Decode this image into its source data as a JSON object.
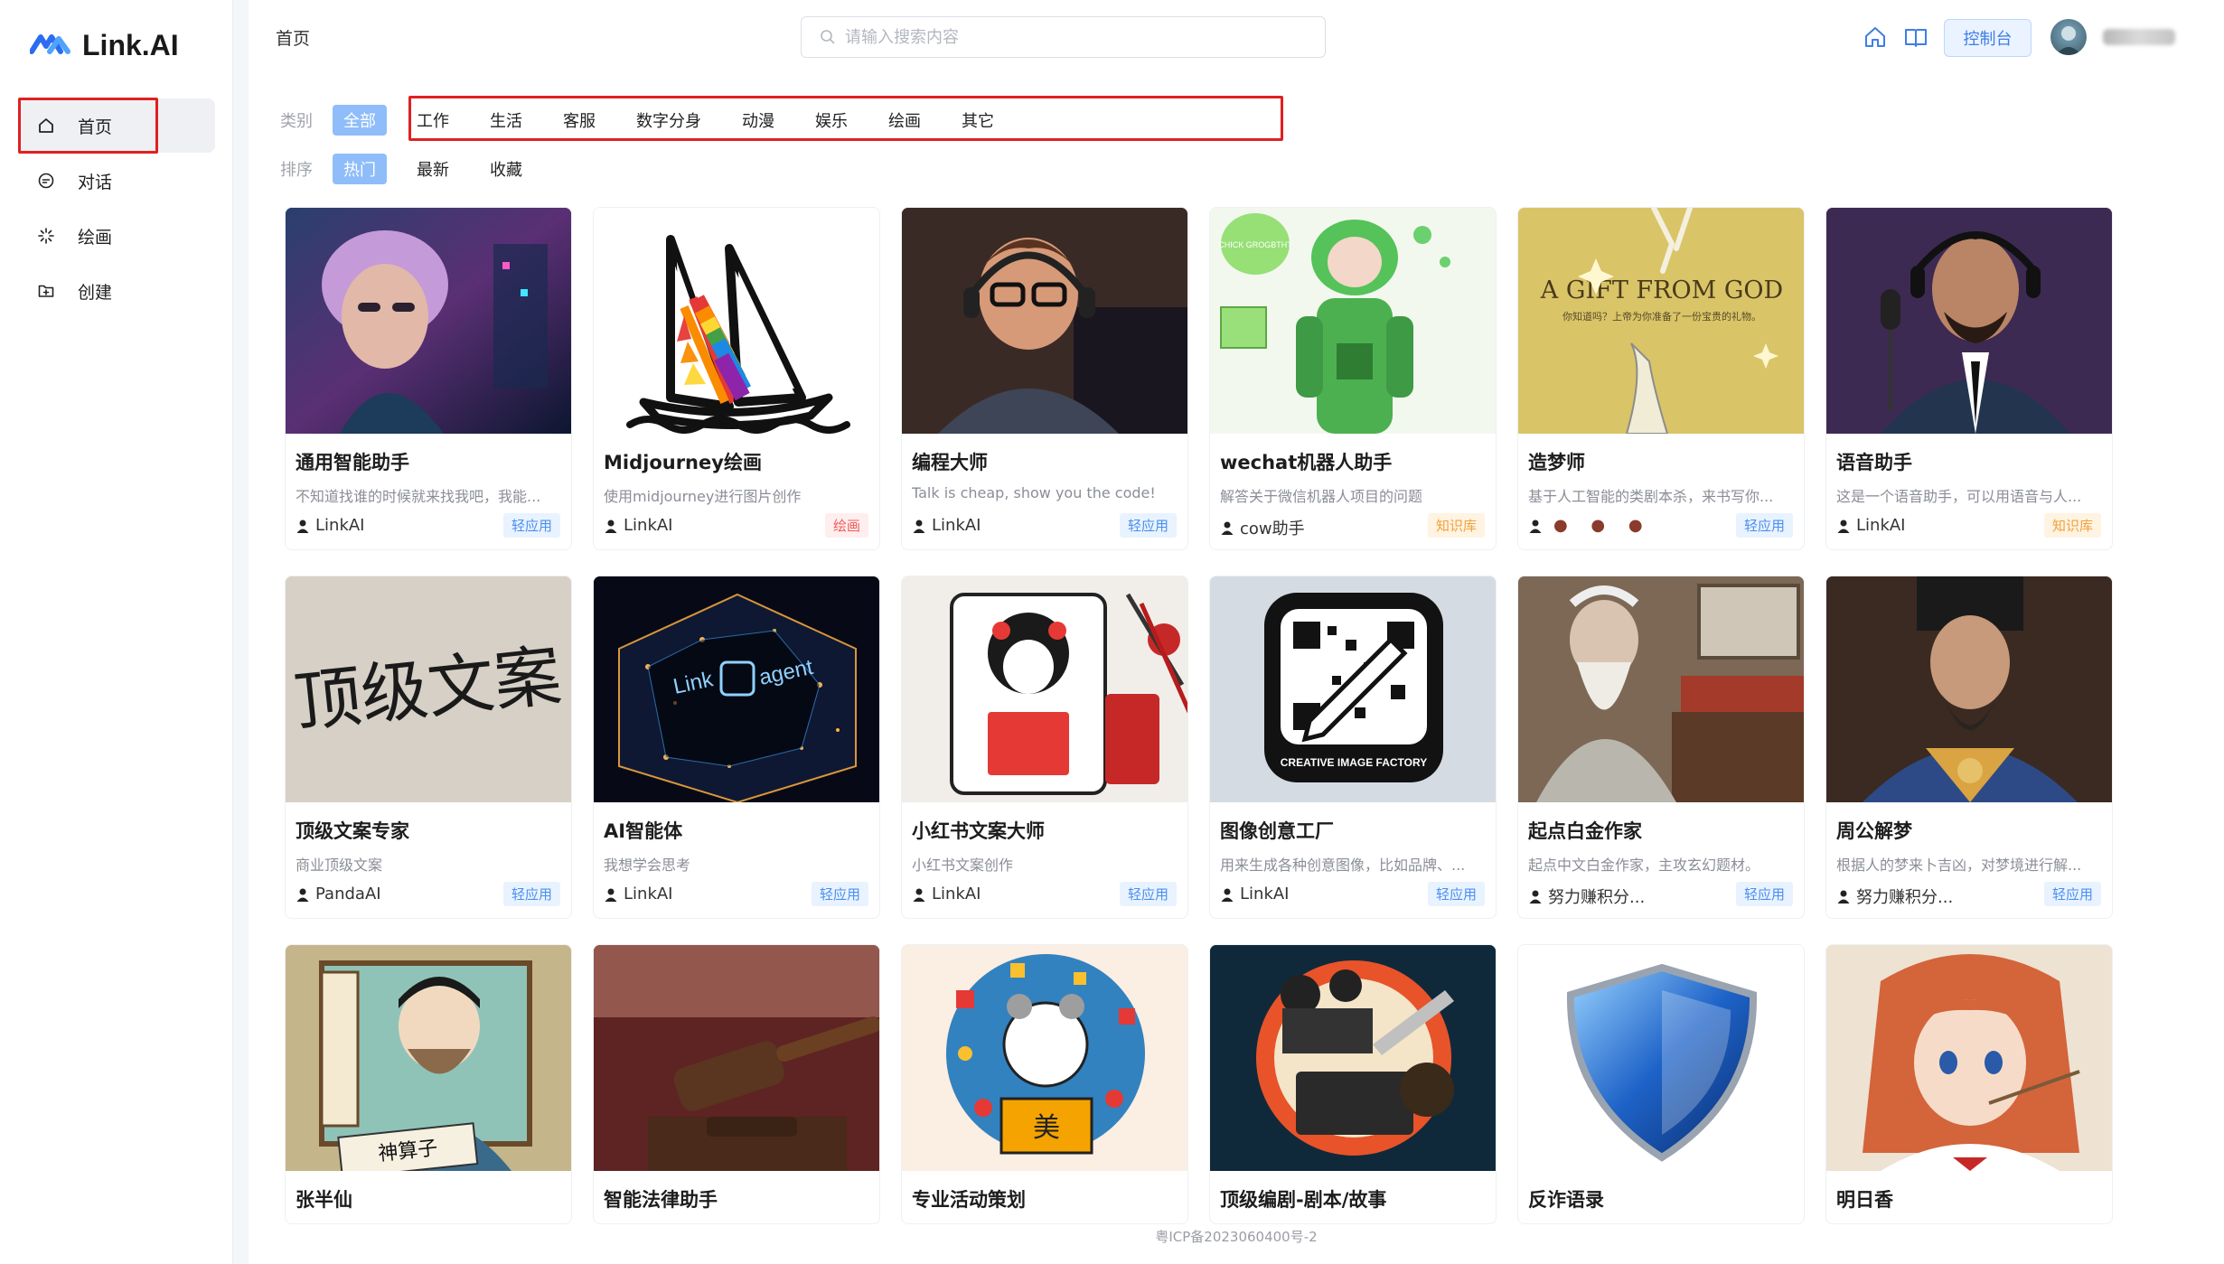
{
  "app": {
    "logo_text": "Link.AI"
  },
  "sidebar": {
    "items": [
      {
        "label": "首页",
        "icon": "home-icon",
        "active": true
      },
      {
        "label": "对话",
        "icon": "chat-icon",
        "active": false
      },
      {
        "label": "绘画",
        "icon": "sparkle-icon",
        "active": false
      },
      {
        "label": "创建",
        "icon": "create-folder-icon",
        "active": false
      }
    ]
  },
  "header": {
    "breadcrumb": "首页",
    "search_placeholder": "请输入搜索内容",
    "console_label": "控制台"
  },
  "filters": {
    "category_label": "类别",
    "categories": [
      "全部",
      "工作",
      "生活",
      "客服",
      "数字分身",
      "动漫",
      "娱乐",
      "绘画",
      "其它"
    ],
    "selected_category": "全部",
    "sort_label": "排序",
    "sorts": [
      "热门",
      "最新",
      "收藏"
    ],
    "selected_sort": "热门"
  },
  "cards": [
    {
      "title": "通用智能助手",
      "desc": "不知道找谁的时候就来找我吧，我能...",
      "author": "LinkAI",
      "tag": "轻应用",
      "tag_color": "blue"
    },
    {
      "title": "Midjourney绘画",
      "desc": "使用midjourney进行图片创作",
      "author": "LinkAI",
      "tag": "绘画",
      "tag_color": "red"
    },
    {
      "title": "编程大师",
      "desc": "Talk is cheap, show you the code!",
      "author": "LinkAI",
      "tag": "轻应用",
      "tag_color": "blue"
    },
    {
      "title": "wechat机器人助手",
      "desc": "解答关于微信机器人项目的问题",
      "author": "cow助手",
      "tag": "知识库",
      "tag_color": "orange"
    },
    {
      "title": "造梦师",
      "desc": "基于人工智能的类剧本杀，来书写你...",
      "author": "",
      "tag": "轻应用",
      "tag_color": "blue"
    },
    {
      "title": "语音助手",
      "desc": "这是一个语音助手，可以用语音与人...",
      "author": "LinkAI",
      "tag": "知识库",
      "tag_color": "orange"
    },
    {
      "title": "顶级文案专家",
      "desc": "商业顶级文案",
      "author": "PandaAI",
      "tag": "轻应用",
      "tag_color": "blue"
    },
    {
      "title": "AI智能体",
      "desc": "我想学会思考",
      "author": "LinkAI",
      "tag": "轻应用",
      "tag_color": "blue"
    },
    {
      "title": "小红书文案大师",
      "desc": "小红书文案创作",
      "author": "LinkAI",
      "tag": "轻应用",
      "tag_color": "blue"
    },
    {
      "title": "图像创意工厂",
      "desc": "用来生成各种创意图像，比如品牌、...",
      "author": "LinkAI",
      "tag": "轻应用",
      "tag_color": "blue"
    },
    {
      "title": "起点白金作家",
      "desc": "起点中文白金作家，主攻玄幻题材。",
      "author": "努力赚积分...",
      "tag": "轻应用",
      "tag_color": "blue"
    },
    {
      "title": "周公解梦",
      "desc": "根据人的梦来卜吉凶，对梦境进行解...",
      "author": "努力赚积分...",
      "tag": "轻应用",
      "tag_color": "blue"
    },
    {
      "title": "张半仙",
      "desc": "",
      "author": "",
      "tag": "",
      "tag_color": "blue"
    },
    {
      "title": "智能法律助手",
      "desc": "",
      "author": "",
      "tag": "",
      "tag_color": "blue"
    },
    {
      "title": "专业活动策划",
      "desc": "",
      "author": "",
      "tag": "",
      "tag_color": "blue"
    },
    {
      "title": "顶级编剧-剧本/故事",
      "desc": "",
      "author": "",
      "tag": "",
      "tag_color": "blue"
    },
    {
      "title": "反诈语录",
      "desc": "",
      "author": "",
      "tag": "",
      "tag_color": "blue"
    },
    {
      "title": "明日香",
      "desc": "",
      "author": "",
      "tag": "",
      "tag_color": "blue"
    }
  ],
  "thumb_texts": {
    "gift_title": "A GIFT FROM GOD",
    "gift_sub": "你知道吗？上帝为你准备了一份宝贵的礼物。",
    "chick": "CHICK GROGBTHT",
    "copywriting": "顶级文案",
    "link_agent_left": "Link",
    "link_agent_right": "agent",
    "factory": "CREATIVE IMAGE FACTORY",
    "scroll_text": "神算子",
    "mei": "美"
  },
  "footer": {
    "icp": "粤ICP备2023060400号-2"
  }
}
